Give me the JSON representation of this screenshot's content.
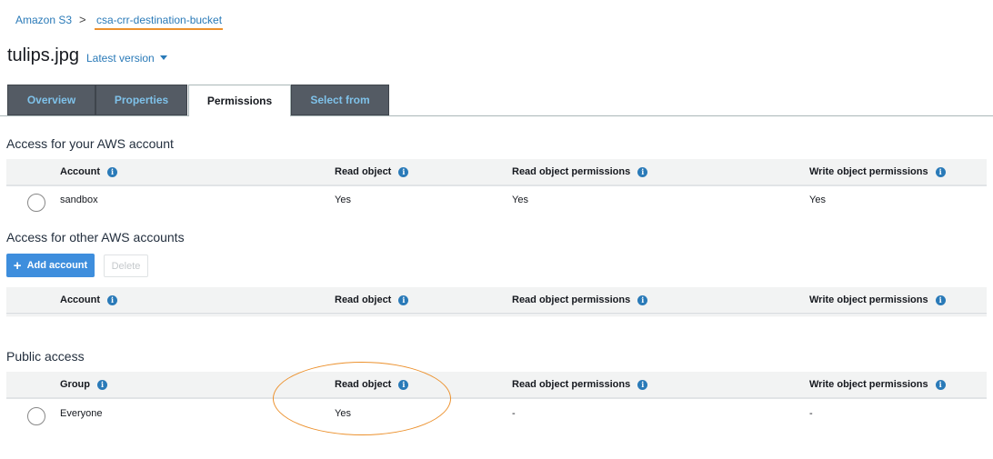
{
  "breadcrumb": {
    "root": "Amazon S3",
    "separator": ">",
    "bucket": "csa-crr-destination-bucket"
  },
  "object": {
    "title": "tulips.jpg",
    "version_label": "Latest version"
  },
  "tabs": [
    {
      "label": "Overview"
    },
    {
      "label": "Properties"
    },
    {
      "label": "Permissions"
    },
    {
      "label": "Select from"
    }
  ],
  "info_glyph": "i",
  "section_aws_account": {
    "heading": "Access for your AWS account",
    "columns": [
      "Account",
      "Read object",
      "Read object permissions",
      "Write object permissions"
    ],
    "rows": [
      {
        "cells": [
          "sandbox",
          "Yes",
          "Yes",
          "Yes"
        ]
      }
    ]
  },
  "section_other_accounts": {
    "heading": "Access for other AWS accounts",
    "add_label": "Add account",
    "add_icon": "+",
    "delete_label": "Delete",
    "columns": [
      "Account",
      "Read object",
      "Read object permissions",
      "Write object permissions"
    ]
  },
  "section_public": {
    "heading": "Public access",
    "columns": [
      "Group",
      "Read object",
      "Read object permissions",
      "Write object permissions"
    ],
    "rows": [
      {
        "cells": [
          "Everyone",
          "Yes",
          "-",
          "-"
        ]
      }
    ]
  },
  "colors": {
    "accent": "#ec912d",
    "link": "#2a7ab8",
    "tab_bg": "#545b64",
    "primary_button": "#3e8edd"
  }
}
